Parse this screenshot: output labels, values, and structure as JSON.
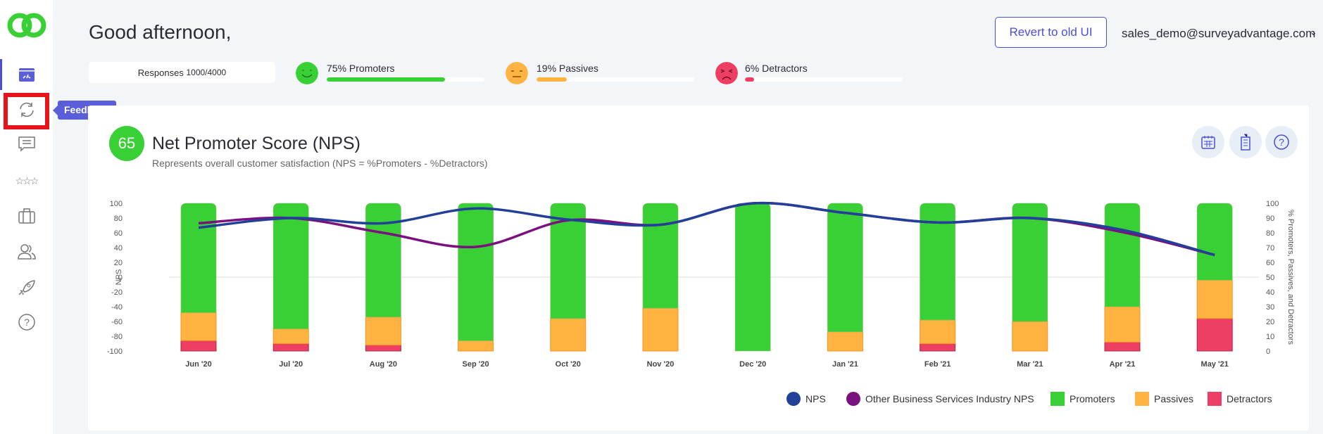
{
  "header": {
    "greeting": "Good afternoon,",
    "revert_label": "Revert to old UI",
    "user_email": "sales_demo@surveyadvantage.com"
  },
  "sidebar": {
    "tooltip": "Feedback",
    "items": [
      "dashboard",
      "feedback",
      "comments",
      "reviews",
      "portfolio",
      "users",
      "launch",
      "help"
    ]
  },
  "stats": {
    "responses_label": "Responses",
    "responses_value": "1000/4000",
    "promoters": {
      "label": "75% Promoters",
      "percent": 75
    },
    "passives": {
      "label": "19% Passives",
      "percent": 19
    },
    "detractors": {
      "label": "6% Detractors",
      "percent": 6
    }
  },
  "card": {
    "nps_score": "65",
    "title": "Net Promoter Score (NPS)",
    "subtitle": "Represents overall customer satisfaction (NPS = %Promoters - %Detractors)"
  },
  "colors": {
    "promoters": "#39d035",
    "passives": "#ffb341",
    "detractors": "#ec3f63",
    "nps": "#22409a",
    "industry": "#7b117f",
    "accent": "#4a4fd6"
  },
  "chart_data": {
    "type": "bar+line",
    "categories": [
      "Jun '20",
      "Jul '20",
      "Aug '20",
      "Sep '20",
      "Oct '20",
      "Nov '20",
      "Dec '20",
      "Jan '21",
      "Feb '21",
      "Mar '21",
      "Apr '21",
      "May '21"
    ],
    "ylabel": "NPS",
    "ylim": [
      -100,
      100
    ],
    "yticks": [
      100,
      80,
      60,
      40,
      20,
      0,
      -20,
      -40,
      -60,
      -80,
      -100
    ],
    "y2label": "% Promoters, Passives, and Detractors",
    "y2lim": [
      0,
      100
    ],
    "y2ticks": [
      100,
      90,
      80,
      70,
      60,
      50,
      40,
      30,
      20,
      10,
      0
    ],
    "series": [
      {
        "name": "NPS",
        "type": "line",
        "values": [
          67,
          80,
          73,
          93,
          78,
          71,
          100,
          87,
          74,
          80,
          64,
          30
        ]
      },
      {
        "name": "Other Business Services Industry NPS",
        "type": "line",
        "values": [
          73,
          80,
          60,
          41,
          77,
          71,
          100,
          87,
          74,
          80,
          61,
          30
        ]
      },
      {
        "name": "Promoters",
        "type": "bar",
        "values": [
          74,
          85,
          77,
          93,
          78,
          71,
          100,
          87,
          79,
          80,
          70,
          52
        ]
      },
      {
        "name": "Passives",
        "type": "bar",
        "values": [
          19,
          10,
          19,
          7,
          22,
          29,
          0,
          13,
          16,
          20,
          24,
          26
        ]
      },
      {
        "name": "Detractors",
        "type": "bar",
        "values": [
          7,
          5,
          4,
          0,
          0,
          0,
          0,
          0,
          5,
          0,
          6,
          22
        ]
      }
    ],
    "legend_position": "bottom-right"
  }
}
